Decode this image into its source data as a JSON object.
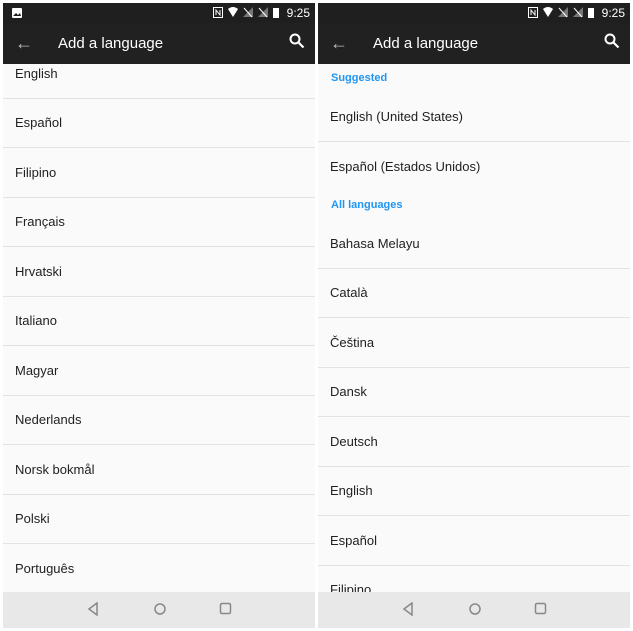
{
  "status_bar": {
    "time": "9:25"
  },
  "toolbar": {
    "title": "Add a language"
  },
  "left_list": [
    "English",
    "Español",
    "Filipino",
    "Français",
    "Hrvatski",
    "Italiano",
    "Magyar",
    "Nederlands",
    "Norsk bokmål",
    "Polski",
    "Português"
  ],
  "right": {
    "suggested_header": "Suggested",
    "suggested": [
      "English (United States)",
      "Español (Estados Unidos)"
    ],
    "all_header": "All languages",
    "all": [
      "Bahasa Melayu",
      "Català",
      "Čeština",
      "Dansk",
      "Deutsch",
      "English",
      "Español",
      "Filipino"
    ]
  },
  "colors": {
    "accent": "#2196f3",
    "toolbar": "#212121"
  }
}
